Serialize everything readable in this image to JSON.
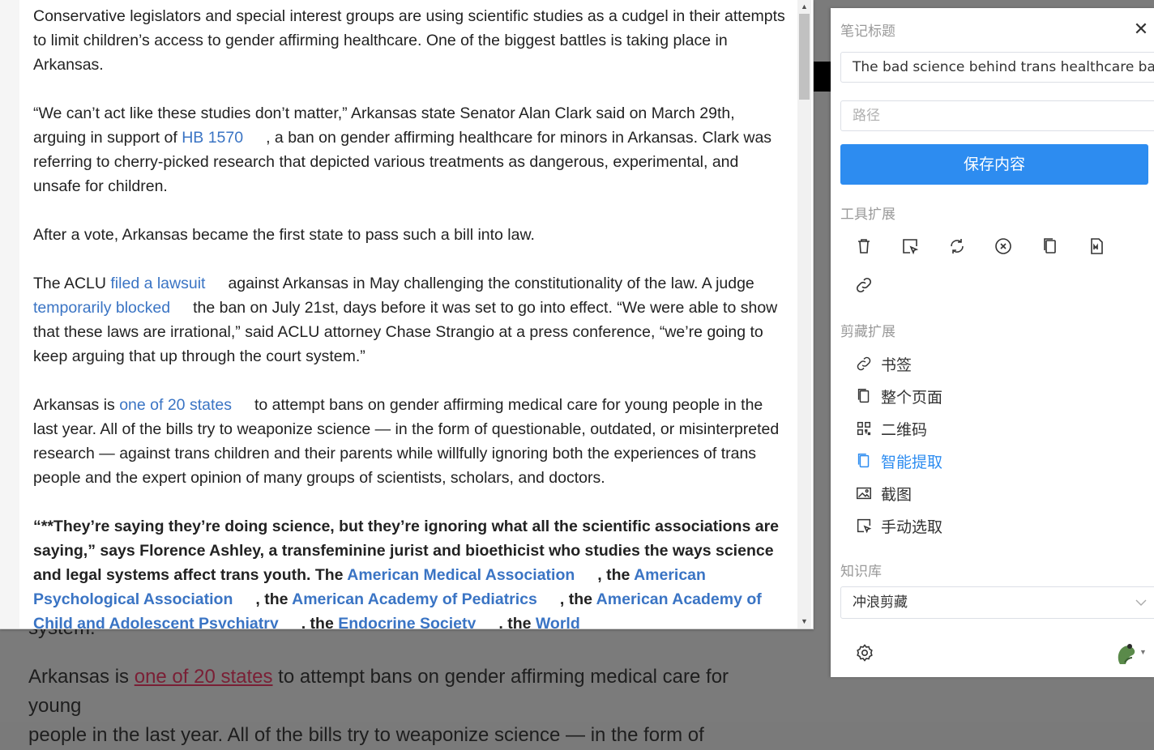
{
  "background": {
    "fragment": "system.”",
    "line1_prefix": "Arkansas is ",
    "line1_link": "one of 20 states",
    "line1_suffix": " to attempt bans on gender affirming medical care for young",
    "line2": "people in the last year. All of the bills try to weaponize science — in the form of"
  },
  "article": {
    "p1": "Conservative legislators and special interest groups are using scientific studies as a cudgel in their attempts to limit children’s access to gender affirming healthcare. One of the biggest battles is taking place in Arkansas.",
    "p2_a": "“We can’t act like these studies don’t matter,” Arkansas state Senator Alan Clark said on March 29th, arguing in support of ",
    "p2_link": "HB 1570",
    "p2_b": ", a ban on gender affirming healthcare for minors in Arkansas. Clark was referring to cherry-picked research that depicted various treatments as dangerous, experimental, and unsafe for children.",
    "p3": "After a vote, Arkansas became the first state to pass such a bill into law.",
    "p4_a": "The ACLU ",
    "p4_link1": "filed a lawsuit",
    "p4_b": "against Arkansas in May challenging the constitutionality of the law. A judge ",
    "p4_link2": "temporarily blocked",
    "p4_c": "the ban on July 21st, days before it was set to go into effect. “We were able to show that these laws are irrational,” said ACLU attorney Chase Strangio at a press conference, “we’re going to keep arguing that up through the court system.”",
    "p5_a": "Arkansas is ",
    "p5_link": "one of 20 states",
    "p5_b": "to attempt bans on gender affirming medical care for young people in the last year. All of the bills try to weaponize science — in the form of questionable, outdated, or misinterpreted research — against trans children and their parents while willfully ignoring both the experiences of trans people and the expert opinion of many groups of scientists, scholars, and doctors.",
    "p6_a": "“**They’re saying they’re doing science, but they’re ignoring what all the scientific associations are saying,” says Florence Ashley, a transfeminine jurist and bioethicist who studies the ways science and legal systems affect trans youth. The ",
    "p6_link1": "American Medical Association",
    "p6_b": ", the ",
    "p6_link2": "American Psychological Association",
    "p6_c": ", the ",
    "p6_link3": "American Academy of Pediatrics",
    "p6_d": ", the ",
    "p6_link4": "American Academy of Child and Adolescent Psychiatry",
    "p6_e": ", the ",
    "p6_link5": "Endocrine Society",
    "p6_f": ", the ",
    "p6_link6": "World"
  },
  "panel": {
    "title_label": "笔记标题",
    "title_value": "The bad science behind trans healthcare bans",
    "path_placeholder": "路径",
    "save_label": "保存内容",
    "tools_label": "工具扩展",
    "clip_label": "剪藏扩展",
    "clip_items": {
      "bookmark": "书签",
      "full_page": "整个页面",
      "qrcode": "二维码",
      "smart": "智能提取",
      "screenshot": "截图",
      "manual": "手动选取"
    },
    "kb_label": "知识库",
    "kb_value": "冲浪剪藏",
    "accent": "#2d8cf0"
  }
}
